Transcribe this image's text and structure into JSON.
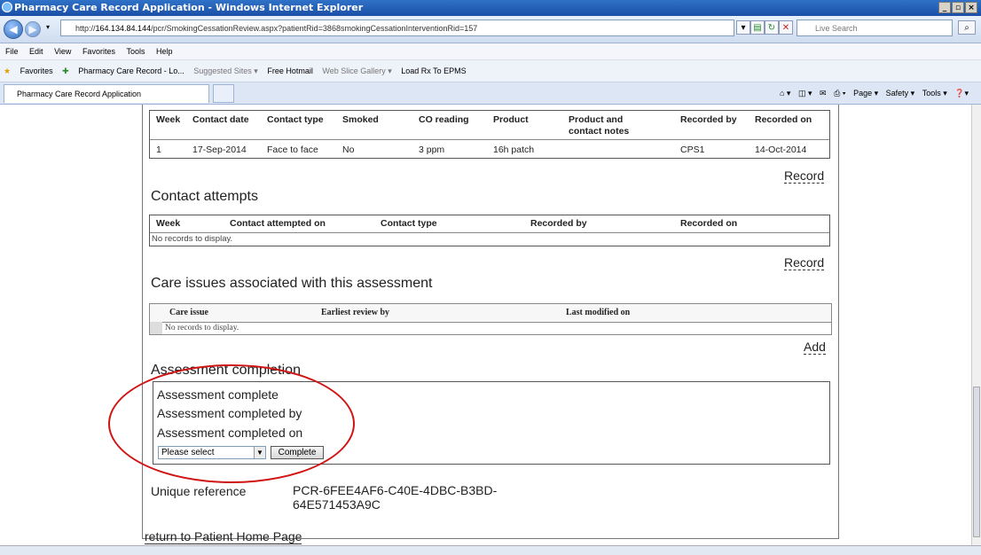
{
  "window": {
    "title": "Pharmacy Care Record Application - Windows Internet Explorer"
  },
  "address": {
    "prefix": "http://",
    "host": "164.134.84.144",
    "path": "/pcr/SmokingCessationReview.aspx?patientRid=3868smokingCessationInterventionRid=157"
  },
  "search": {
    "placeholder": "Live Search"
  },
  "menu": {
    "items": [
      "File",
      "Edit",
      "View",
      "Favorites",
      "Tools",
      "Help"
    ]
  },
  "favorites": {
    "label": "Favorites",
    "items": [
      "Pharmacy Care Record - Lo...",
      "Suggested Sites ▾",
      "Free Hotmail",
      "Web Slice Gallery ▾",
      "Load Rx To EPMS"
    ]
  },
  "tab": {
    "label": "Pharmacy Care Record Application"
  },
  "commandbar": {
    "page": "Page ▾",
    "safety": "Safety ▾",
    "tools": "Tools ▾"
  },
  "contacts_table": {
    "headers": [
      "Week",
      "Contact date",
      "Contact type",
      "Smoked",
      "CO reading",
      "Product",
      "Product and contact notes",
      "Recorded by",
      "Recorded on"
    ],
    "row": [
      "1",
      "17-Sep-2014",
      "Face to face",
      "No",
      "3 ppm",
      "16h patch",
      "",
      "CPS1",
      "14-Oct-2014"
    ]
  },
  "record_link_1": "Record",
  "contact_attempts": {
    "title": "Contact attempts",
    "headers": [
      "Week",
      "Contact attempted on",
      "Contact type",
      "Recorded by",
      "Recorded on"
    ],
    "empty": "No records to display."
  },
  "record_link_2": "Record",
  "care_issues": {
    "title": "Care issues associated with this assessment",
    "headers": [
      "Care issue",
      "Earliest review by",
      "Last modified on"
    ],
    "empty": "No records to display."
  },
  "add_link": "Add",
  "assessment": {
    "title": "Assessment completion",
    "complete": "Assessment complete",
    "completed_by": "Assessment completed by",
    "completed_on": "Assessment completed on",
    "select_value": "Please select",
    "button": "Complete"
  },
  "unique_ref": {
    "label": "Unique reference",
    "line1": "PCR-6FEE4AF6-C40E-4DBC-B3BD-",
    "line2": "64E571453A9C"
  },
  "return_link": "return to Patient Home Page",
  "colors": {
    "annotation": "#d01515",
    "titlebar": "#2f72c8"
  }
}
